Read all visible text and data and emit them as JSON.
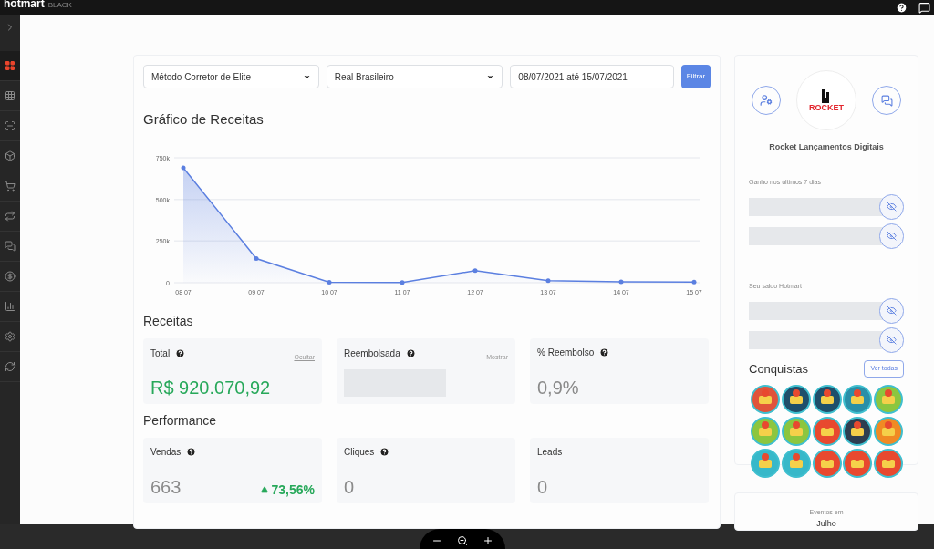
{
  "topbar": {
    "brand": "hotmart",
    "edition": "BLACK"
  },
  "sidebar": {
    "items": [
      {
        "selected": true
      },
      {
        "selected": false
      },
      {
        "selected": false
      },
      {
        "selected": false
      },
      {
        "selected": false
      },
      {
        "selected": false
      },
      {
        "selected": false
      },
      {
        "selected": false
      },
      {
        "selected": false
      },
      {
        "selected": false
      },
      {
        "selected": false
      }
    ]
  },
  "filters": {
    "product": "Método Corretor de Elite",
    "currency": "Real Brasileiro",
    "date_range": "08/07/2021 até 15/07/2021",
    "button": "Filtrar"
  },
  "revenue_chart": {
    "title": "Gráfico de Receitas",
    "chart_data": {
      "type": "area",
      "categories": [
        "08 07",
        "09 07",
        "10 07",
        "11 07",
        "12 07",
        "13 07",
        "14 07",
        "15 07"
      ],
      "series": [
        {
          "color": "#5b7fe0",
          "values": [
            690000,
            145000,
            3000,
            2000,
            72000,
            12000,
            5000,
            4000
          ]
        }
      ],
      "ylim": [
        0,
        750000
      ],
      "yticks": [
        {
          "value": 0,
          "label": "0"
        },
        {
          "value": 250000,
          "label": "250k"
        },
        {
          "value": 500000,
          "label": "500k"
        },
        {
          "value": 750000,
          "label": "750k"
        }
      ]
    }
  },
  "sections": [
    {
      "title": "Receitas",
      "cards": [
        {
          "label": "Total",
          "help": true,
          "toggle": "Ocultar",
          "hidden": false,
          "value": "R$ 920.070,92",
          "accent": true
        },
        {
          "label": "Reembolsada",
          "help": true,
          "toggle": "Mostrar",
          "hidden": true
        },
        {
          "label": "% Reembolso",
          "help": true,
          "hidden": false,
          "value": "0,9%",
          "accent": false
        }
      ]
    },
    {
      "title": "Performance",
      "cards": [
        {
          "label": "Vendas",
          "help": true,
          "hidden": false,
          "value": "663",
          "accent": false,
          "trend": "73,56%"
        },
        {
          "label": "Cliques",
          "help": true,
          "hidden": false,
          "value": "0",
          "accent": false
        },
        {
          "label": "Leads",
          "help": false,
          "hidden": false,
          "value": "0",
          "accent": false
        }
      ]
    }
  ],
  "profile": {
    "logo_text": "ROCKET",
    "name": "Rocket Lançamentos Digitais",
    "balances": [
      {
        "label": "Ganho nos últimos 7 dias",
        "rows": [
          {
            "hidden": true
          },
          {
            "hidden": true
          }
        ]
      },
      {
        "label": "Seu saldo Hotmart",
        "rows": [
          {
            "hidden": true
          },
          {
            "hidden": true
          }
        ]
      }
    ],
    "achievements": {
      "title": "Conquistas",
      "button": "Ver todas",
      "badges": [
        {
          "color": "#e0533a"
        },
        {
          "color": "#1f4f6b"
        },
        {
          "color": "#1f4f6b"
        },
        {
          "color": "#2a8fa8"
        },
        {
          "color": "#8cc63f"
        },
        {
          "color": "#8cc63f"
        },
        {
          "color": "#8cc63f"
        },
        {
          "color": "#e8492f"
        },
        {
          "color": "#2d3e50"
        },
        {
          "color": "#f08a24"
        },
        {
          "color": "#37b8c9"
        },
        {
          "color": "#37b8c9"
        },
        {
          "color": "#e8492f"
        },
        {
          "color": "#e8492f"
        },
        {
          "color": "#e8492f"
        }
      ]
    }
  },
  "events": {
    "title": "Eventos em",
    "month": "Julho"
  }
}
